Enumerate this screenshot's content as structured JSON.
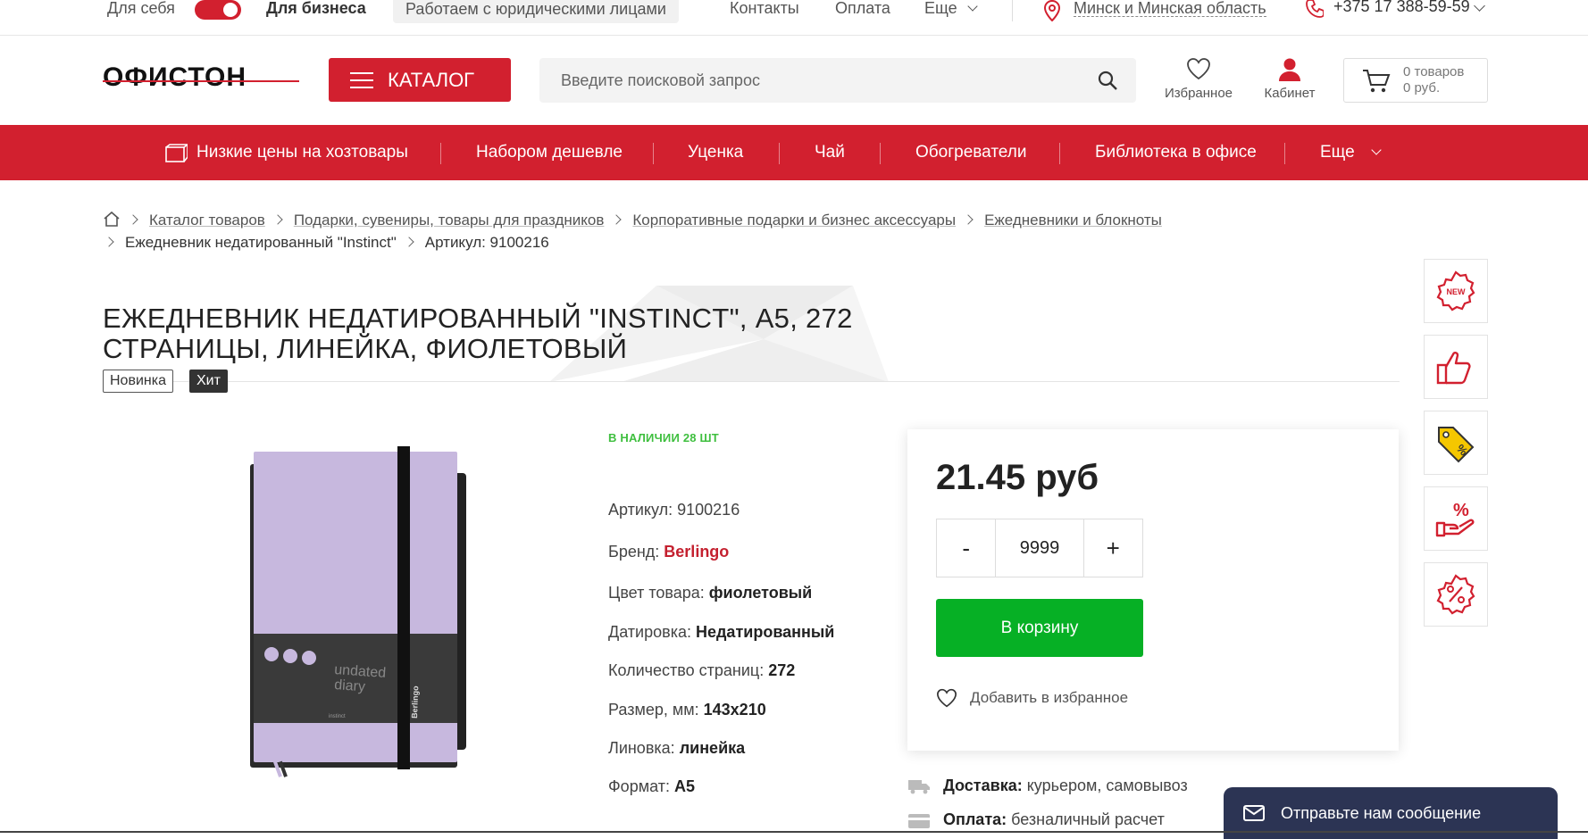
{
  "topbar": {
    "for_self": "Для себя",
    "for_business": "Для бизнеса",
    "legal_entities": "Работаем с юридическими лицами",
    "contacts": "Контакты",
    "payment": "Оплата",
    "more": "Еще",
    "region": "Минск и Минская область",
    "phone": "+375 17 388-59-59"
  },
  "header": {
    "logo": "ОФИСТОН",
    "catalog_label": "КАТАЛОГ",
    "search_placeholder": "Введите поисковой запрос",
    "favorites_label": "Избранное",
    "cabinet_label": "Кабинет",
    "cart_count": "0 товаров",
    "cart_sum": "0 руб."
  },
  "nav": {
    "items": [
      "Низкие цены на хозтовары",
      "Набором дешевле",
      "Уценка",
      "Чай",
      "Обогреватели",
      "Библиотека в офисе",
      "Еще"
    ]
  },
  "breadcrumbs": {
    "items": [
      "Каталог товаров",
      "Подарки, сувениры, товары для праздников",
      "Корпоративные подарки и бизнес аксессуары",
      "Ежедневники и блокноты"
    ],
    "product": "Ежедневник недатированный \"Instinct\"",
    "article": "Артикул: 9100216"
  },
  "product": {
    "title_line1": "Ежедневник недатированный \"Instinct\", А5, 272",
    "title_line2": "страницы, линейка, фиолетовый",
    "badge_new": "Новинка",
    "badge_hit": "Хит",
    "stock": "В НАЛИЧИИ 28 ШТ",
    "image_text1": "undated",
    "image_text2": "diary",
    "image_brand": "Berlingo",
    "image_line": "instinct",
    "props": {
      "article_label": "Артикул:",
      "article_value": "9100216",
      "brand_label": "Бренд:",
      "brand_value": "Berlingo",
      "color_label": "Цвет товара:",
      "color_value": "фиолетовый",
      "dating_label": "Датировка:",
      "dating_value": "Недатированный",
      "pages_label": "Количество страниц:",
      "pages_value": "272",
      "size_label": "Размер, мм:",
      "size_value": "143x210",
      "ruling_label": "Линовка:",
      "ruling_value": "линейка",
      "format_label": "Формат:",
      "format_value": "A5"
    },
    "price": "21.45 руб",
    "qty_minus": "-",
    "qty_value": "9999",
    "qty_plus": "+",
    "to_cart": "В корзину",
    "add_fav": "Добавить в избранное"
  },
  "delivery": {
    "delivery_label": "Доставка:",
    "delivery_value": "курьером, самовывоз",
    "payment_label": "Оплата:",
    "payment_value": "безналичный расчет"
  },
  "sidebar_icons": [
    "new-icon",
    "thumbs-up-icon",
    "tag-icon",
    "discount-hand-icon",
    "percent-badge-icon"
  ],
  "side_labels": {
    "new": "NEW"
  },
  "chat": {
    "label": "Отправьте нам сообщение"
  },
  "colors": {
    "accent": "#d2202f",
    "green": "#06b025",
    "chat": "#2c3454"
  }
}
